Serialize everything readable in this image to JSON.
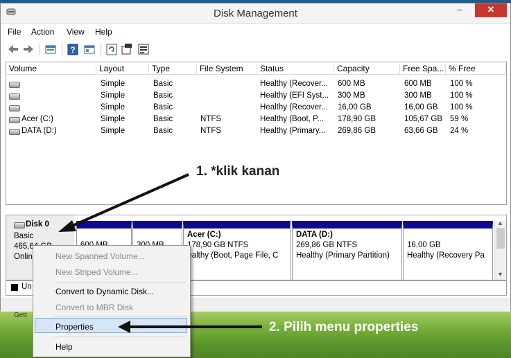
{
  "window": {
    "title": "Disk Management"
  },
  "menu": [
    "File",
    "Action",
    "View",
    "Help"
  ],
  "toolbar": {
    "buttons": [
      "back-icon",
      "forward-icon",
      "disk-list-icon",
      "help-icon",
      "list-view-icon",
      "refresh-icon",
      "properties-icon",
      "settings-icon"
    ]
  },
  "volume_table": {
    "headers": [
      "Volume",
      "Layout",
      "Type",
      "File System",
      "Status",
      "Capacity",
      "Free Spa...",
      "% Free"
    ],
    "rows": [
      {
        "volume": "",
        "layout": "Simple",
        "type": "Basic",
        "fs": "",
        "status": "Healthy (Recover...",
        "capacity": "600 MB",
        "free": "600 MB",
        "pct": "100 %"
      },
      {
        "volume": "",
        "layout": "Simple",
        "type": "Basic",
        "fs": "",
        "status": "Healthy (EFI Syst...",
        "capacity": "300 MB",
        "free": "300 MB",
        "pct": "100 %"
      },
      {
        "volume": "",
        "layout": "Simple",
        "type": "Basic",
        "fs": "",
        "status": "Healthy (Recover...",
        "capacity": "16,00 GB",
        "free": "16,00 GB",
        "pct": "100 %"
      },
      {
        "volume": "Acer (C:)",
        "layout": "Simple",
        "type": "Basic",
        "fs": "NTFS",
        "status": "Healthy (Boot, P...",
        "capacity": "178,90 GB",
        "free": "105,67 GB",
        "pct": "59 %"
      },
      {
        "volume": "DATA (D:)",
        "layout": "Simple",
        "type": "Basic",
        "fs": "NTFS",
        "status": "Healthy (Primary...",
        "capacity": "269,86 GB",
        "free": "63,66 GB",
        "pct": "24 %"
      }
    ]
  },
  "disk": {
    "name": "Disk 0",
    "type": "Basic",
    "size": "465,64 GB",
    "state": "Onlin"
  },
  "partitions": [
    {
      "name": "",
      "line1": "600 MB",
      "line2": ""
    },
    {
      "name": "",
      "line1": "300 MB",
      "line2": ""
    },
    {
      "name": "Acer  (C:)",
      "line1": "178,90 GB NTFS",
      "line2": "Healthy (Boot, Page File, C"
    },
    {
      "name": "DATA  (D:)",
      "line1": "269,86 GB NTFS",
      "line2": "Healthy (Primary Partition)"
    },
    {
      "name": "",
      "line1": "16,00 GB",
      "line2": "Healthy (Recovery Pa"
    }
  ],
  "legend": {
    "text": "Un"
  },
  "context_menu": {
    "items": [
      {
        "label": "New Spanned Volume...",
        "enabled": false
      },
      {
        "label": "New Striped Volume...",
        "enabled": false
      },
      {
        "label": "Convert to Dynamic Disk...",
        "enabled": true
      },
      {
        "label": "Convert to MBR Disk",
        "enabled": false
      },
      {
        "label": "Properties",
        "enabled": true,
        "highlighted": true
      },
      {
        "label": "Help",
        "enabled": true
      }
    ]
  },
  "annotations": {
    "step1": "1. *klik kanan",
    "step2": "2. Pilih menu properties"
  },
  "desktop_label": "Gett",
  "colors": {
    "partition_bar": "#0d0a8f",
    "close_button": "#c7372d",
    "highlight": "#d5e6f8"
  }
}
